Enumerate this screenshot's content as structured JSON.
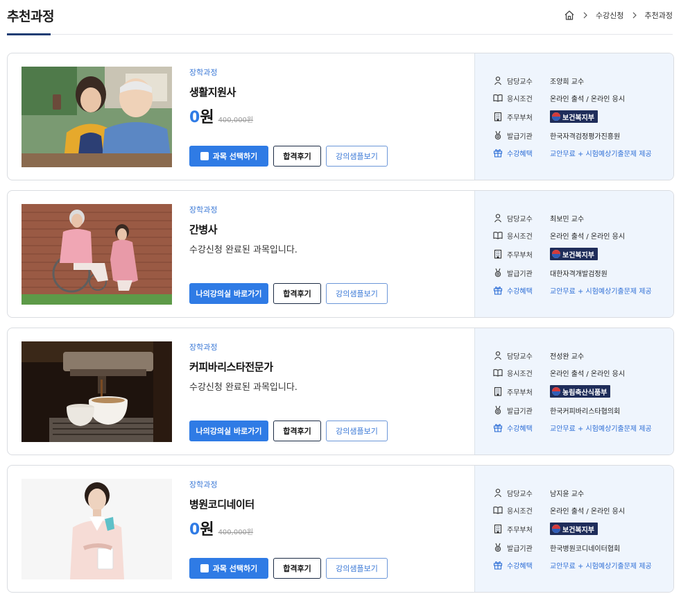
{
  "page": {
    "title": "추천과정",
    "breadcrumb": [
      "수강신청",
      "추천과정"
    ]
  },
  "labels": {
    "professor": "담당교수",
    "condition": "응시조건",
    "ministry": "주무부처",
    "issuer": "발급기관",
    "benefit": "수강혜택"
  },
  "buttons": {
    "select": "과목 선택하기",
    "classroom": "나의강의실 바로가기",
    "review": "합격후기",
    "sample": "강의샘플보기"
  },
  "courses": [
    {
      "category": "장학과정",
      "name": "생활지원사",
      "price_num": "0",
      "price_unit": "원",
      "original_price": "400,000원",
      "status": "",
      "primary_action": "select",
      "professor": "조양희 교수",
      "condition": "온라인 출석 / 온라인 응시",
      "ministry": "보건복지부",
      "issuer": "한국자격검정평가진흥원",
      "benefit": "교안무료 + 시험예상기출문제 제공"
    },
    {
      "category": "장학과정",
      "name": "간병사",
      "price_num": "",
      "price_unit": "",
      "original_price": "",
      "status": "수강신청 완료된 과목입니다.",
      "primary_action": "classroom",
      "professor": "최보민 교수",
      "condition": "온라인 출석 / 온라인 응시",
      "ministry": "보건복지부",
      "issuer": "대한자격개발검정원",
      "benefit": "교안무료 + 시험예상기출문제 제공"
    },
    {
      "category": "장학과정",
      "name": "커피바리스타전문가",
      "price_num": "",
      "price_unit": "",
      "original_price": "",
      "status": "수강신청 완료된 과목입니다.",
      "primary_action": "classroom",
      "professor": "전성완 교수",
      "condition": "온라인 출석 / 온라인 응시",
      "ministry": "농림축산식품부",
      "issuer": "한국커피바리스타협의회",
      "benefit": "교안무료 + 시험예상기출문제 제공"
    },
    {
      "category": "장학과정",
      "name": "병원코디네이터",
      "price_num": "0",
      "price_unit": "원",
      "original_price": "400,000원",
      "status": "",
      "primary_action": "select",
      "professor": "남지윤 교수",
      "condition": "온라인 출석 / 온라인 응시",
      "ministry": "보건복지부",
      "issuer": "한국병원코디네이터협회",
      "benefit": "교안무료 + 시험예상기출문제 제공"
    }
  ],
  "colors": {
    "accent": "#2f7be5",
    "navy": "#1d3d73",
    "detail_bg": "#eff5fd"
  }
}
